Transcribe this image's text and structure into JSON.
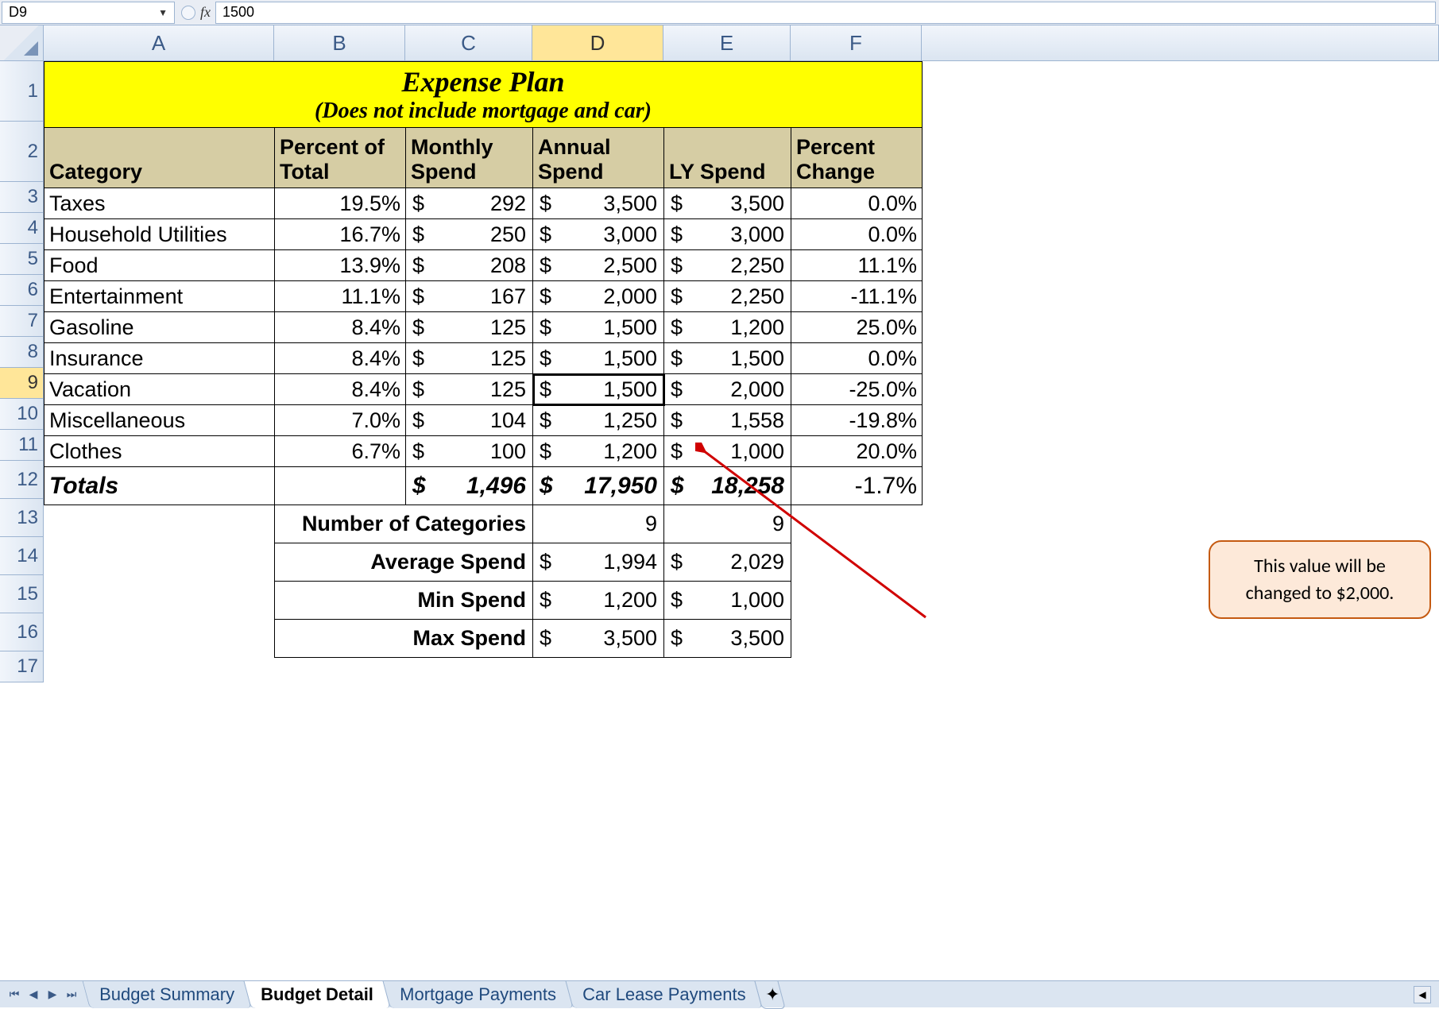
{
  "formula_bar": {
    "name_box": "D9",
    "fx": "fx",
    "value": "1500"
  },
  "columns": [
    "A",
    "B",
    "C",
    "D",
    "E",
    "F"
  ],
  "active_col": "D",
  "rows": [
    1,
    2,
    3,
    4,
    5,
    6,
    7,
    8,
    9,
    10,
    11,
    12,
    13,
    14,
    15,
    16,
    17
  ],
  "active_row": 9,
  "title": {
    "main": "Expense Plan",
    "sub": "(Does not include mortgage and car)"
  },
  "headers": {
    "category": "Category",
    "percent": "Percent of Total",
    "monthly": "Monthly Spend",
    "annual": "Annual Spend",
    "ly": "LY Spend",
    "change": "Percent Change"
  },
  "data": [
    {
      "cat": "Taxes",
      "pct": "19.5%",
      "monthly": "292",
      "annual": "3,500",
      "ly": "3,500",
      "chg": "0.0%"
    },
    {
      "cat": "Household Utilities",
      "pct": "16.7%",
      "monthly": "250",
      "annual": "3,000",
      "ly": "3,000",
      "chg": "0.0%"
    },
    {
      "cat": "Food",
      "pct": "13.9%",
      "monthly": "208",
      "annual": "2,500",
      "ly": "2,250",
      "chg": "11.1%"
    },
    {
      "cat": "Entertainment",
      "pct": "11.1%",
      "monthly": "167",
      "annual": "2,000",
      "ly": "2,250",
      "chg": "-11.1%"
    },
    {
      "cat": "Gasoline",
      "pct": "8.4%",
      "monthly": "125",
      "annual": "1,500",
      "ly": "1,200",
      "chg": "25.0%"
    },
    {
      "cat": "Insurance",
      "pct": "8.4%",
      "monthly": "125",
      "annual": "1,500",
      "ly": "1,500",
      "chg": "0.0%"
    },
    {
      "cat": "Vacation",
      "pct": "8.4%",
      "monthly": "125",
      "annual": "1,500",
      "ly": "2,000",
      "chg": "-25.0%"
    },
    {
      "cat": "Miscellaneous",
      "pct": "7.0%",
      "monthly": "104",
      "annual": "1,250",
      "ly": "1,558",
      "chg": "-19.8%"
    },
    {
      "cat": "Clothes",
      "pct": "6.7%",
      "monthly": "100",
      "annual": "1,200",
      "ly": "1,000",
      "chg": "20.0%"
    }
  ],
  "totals": {
    "label": "Totals",
    "monthly": "1,496",
    "annual": "17,950",
    "ly": "18,258",
    "chg": "-1.7%"
  },
  "stats": [
    {
      "label": "Number of Categories",
      "d": "9",
      "e": "9",
      "money": false
    },
    {
      "label": "Average Spend",
      "d": "1,994",
      "e": "2,029",
      "money": true
    },
    {
      "label": "Min Spend",
      "d": "1,200",
      "e": "1,000",
      "money": true
    },
    {
      "label": "Max Spend",
      "d": "3,500",
      "e": "3,500",
      "money": true
    }
  ],
  "callout": "This value will be changed to $2,000.",
  "sheets": {
    "tabs": [
      "Budget Summary",
      "Budget Detail",
      "Mortgage Payments",
      "Car Lease Payments"
    ],
    "active": "Budget Detail"
  },
  "currency": "$"
}
